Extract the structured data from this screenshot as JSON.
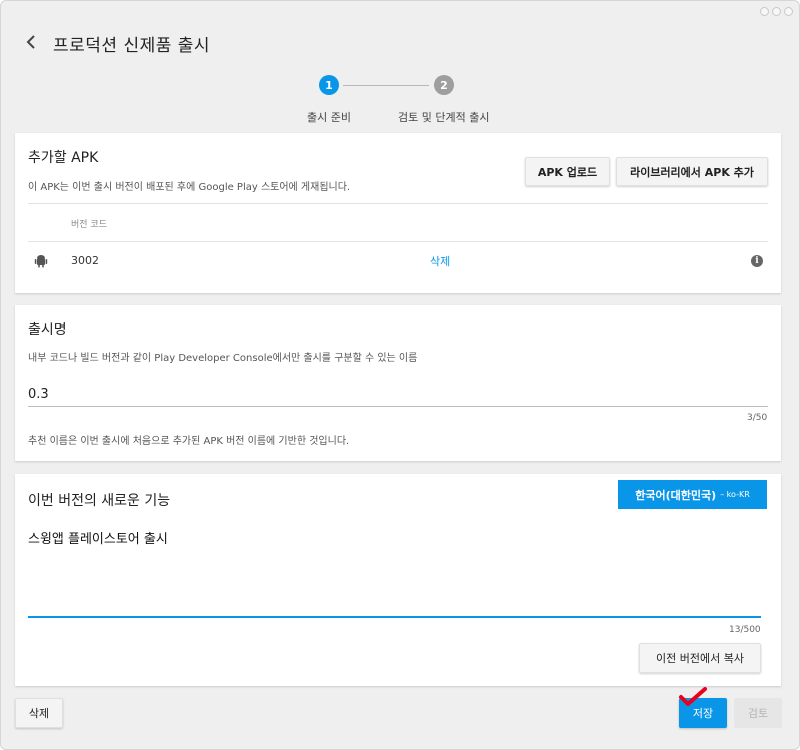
{
  "header": {
    "title": "프로덕션 신제품 출시"
  },
  "stepper": {
    "steps": [
      {
        "number": "1",
        "label": "출시 준비"
      },
      {
        "number": "2",
        "label": "검토 및 단계적 출시"
      }
    ]
  },
  "apk_section": {
    "title": "추가할 APK",
    "description": "이 APK는 이번 출시 버전이 배포된 후에 Google Play 스토어에 게재됩니다.",
    "upload_button": "APK 업로드",
    "library_button": "라이브러리에서 APK 추가",
    "column_header": "버전 코드",
    "rows": [
      {
        "version_code": "3002",
        "delete_label": "삭제",
        "info": "i"
      }
    ]
  },
  "release_name": {
    "title": "출시명",
    "description": "내부 코드나 빌드 버전과 같이 Play Developer Console에서만 출시를 구분할 수 있는 이름",
    "value": "0.3",
    "counter": "3/50",
    "hint": "추천 이름은 이번 출시에 처음으로 추가된 APK 버전 이름에 기반한 것입니다."
  },
  "whats_new": {
    "title": "이번 버전의 새로운 기능",
    "language_label": "한국어(대한민국)",
    "language_code": "– ko-KR",
    "text": "스윙앱 플레이스토어 출시",
    "counter": "13/500",
    "copy_button": "이전 버전에서 복사"
  },
  "footer": {
    "delete_button": "삭제",
    "save_button": "저장",
    "review_button": "검토"
  },
  "colors": {
    "accent": "#0a96e8",
    "step_inactive": "#9e9e9e",
    "annotation": "#e8001c"
  },
  "icons": [
    "back-arrow-icon",
    "android-icon",
    "info-icon",
    "checkmark-icon"
  ]
}
